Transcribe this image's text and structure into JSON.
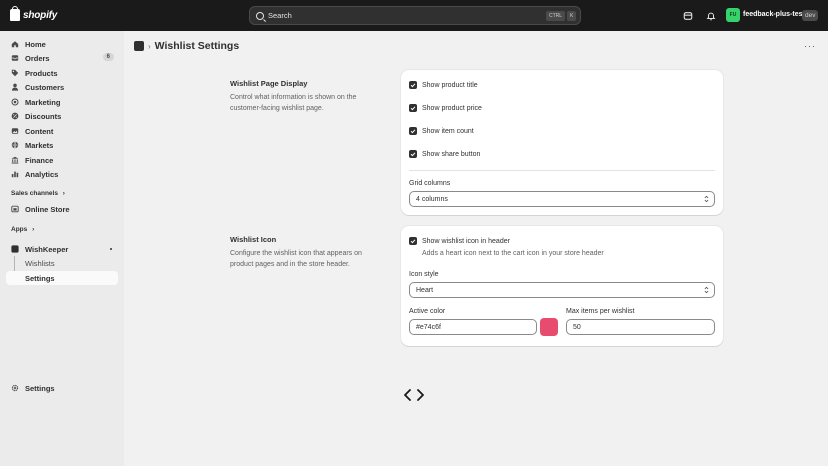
{
  "topbar": {
    "brand": "shopify",
    "search_placeholder": "Search",
    "kbd_ctrl": "CTRL",
    "kbd_k": "K",
    "store_initials": "FU",
    "store_name": "feedback-plus-test",
    "store_badge": "dev"
  },
  "sidebar": {
    "items": [
      {
        "label": "Home",
        "icon": "home-icon"
      },
      {
        "label": "Orders",
        "icon": "orders-icon",
        "count": "6"
      },
      {
        "label": "Products",
        "icon": "tag-icon"
      },
      {
        "label": "Customers",
        "icon": "person-icon"
      },
      {
        "label": "Marketing",
        "icon": "target-icon"
      },
      {
        "label": "Discounts",
        "icon": "discount-icon"
      },
      {
        "label": "Content",
        "icon": "image-icon"
      },
      {
        "label": "Markets",
        "icon": "globe-icon"
      },
      {
        "label": "Finance",
        "icon": "bank-icon"
      },
      {
        "label": "Analytics",
        "icon": "bar-chart-icon"
      }
    ],
    "sales_channels_label": "Sales channels",
    "online_store": "Online Store",
    "apps_label": "Apps",
    "app_name": "WishKeeper",
    "app_sub_wishlists": "Wishlists",
    "app_sub_settings": "Settings",
    "footer_settings": "Settings"
  },
  "page": {
    "title": "Wishlist Settings"
  },
  "display_section": {
    "title": "Wishlist Page Display",
    "description": "Control what information is shown on the customer-facing wishlist page.",
    "options": [
      {
        "label": "Show product title",
        "checked": true
      },
      {
        "label": "Show product price",
        "checked": true
      },
      {
        "label": "Show item count",
        "checked": true
      },
      {
        "label": "Show share button",
        "checked": true
      }
    ],
    "grid_columns_label": "Grid columns",
    "grid_columns_value": "4 columns"
  },
  "icon_section": {
    "title": "Wishlist Icon",
    "description": "Configure the wishlist icon that appears on product pages and in the store header.",
    "show_icon_label": "Show wishlist icon in header",
    "show_icon_help": "Adds a heart icon next to the cart icon in your store header",
    "show_icon_checked": true,
    "icon_style_label": "Icon style",
    "icon_style_value": "Heart",
    "active_color_label": "Active color",
    "active_color_value": "#e74c6f",
    "max_items_label": "Max items per wishlist",
    "max_items_value": "50"
  },
  "colors": {
    "topbar": "#1a1a1a",
    "store_badge": "#36d36b",
    "active_swatch": "#e74c6f",
    "checkbox": "#303030"
  }
}
